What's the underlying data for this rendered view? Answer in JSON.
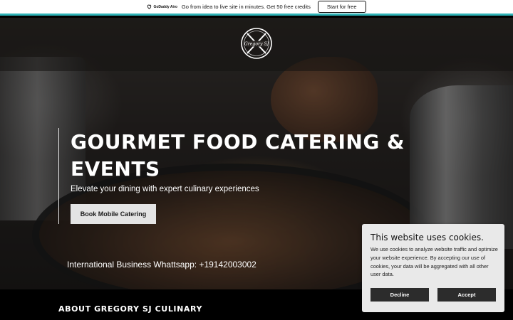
{
  "promo": {
    "brand": "GoDaddy Airo",
    "text": "Go from idea to live site in minutes. Get 50 free credits",
    "cta": "Start for free"
  },
  "hero": {
    "logo_text": "Gregory SJ",
    "title": "GOURMET FOOD CATERING & EVENTS",
    "subtitle": "Elevate your dining with expert culinary experiences",
    "cta": "Book Mobile Catering",
    "whatsapp": "International Business Whattsapp: +19142003002"
  },
  "about": {
    "heading": "ABOUT GREGORY SJ CULINARY"
  },
  "cookie": {
    "title": "This website uses cookies.",
    "body": "We use cookies to analyze website traffic and optimize your website experience. By accepting our use of cookies, your data will be aggregated with all other user data.",
    "decline": "Decline",
    "accept": "Accept"
  },
  "colors": {
    "banner_accent": "#2fb3b7",
    "button_light": "#e4e4e4",
    "button_dark": "#2c2c2c",
    "cookie_bg": "#e9e9e9"
  }
}
